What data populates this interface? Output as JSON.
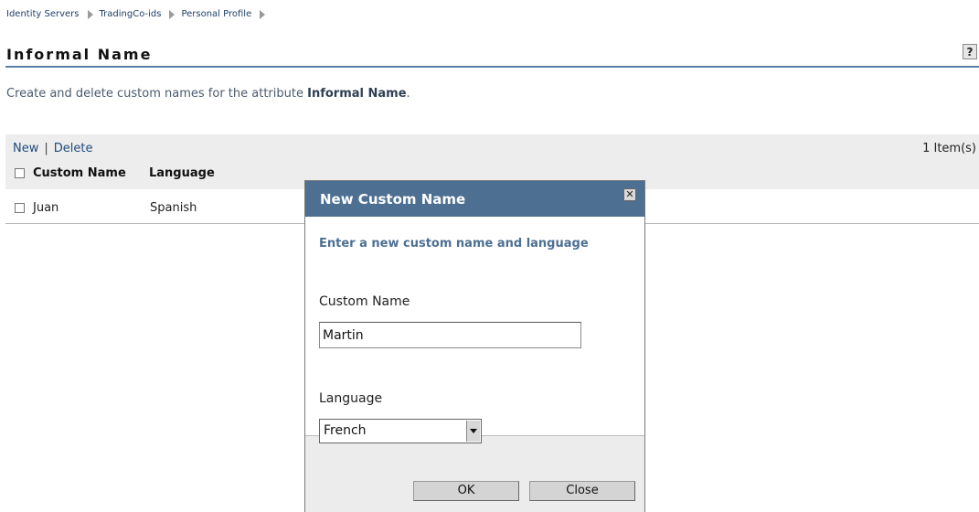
{
  "breadcrumb": [
    "Identity Servers",
    "TradingCo-ids",
    "Personal Profile"
  ],
  "page": {
    "title": "Informal Name",
    "help_label": "?",
    "description_prefix": "Create and delete custom names for the attribute ",
    "description_attribute": "Informal Name",
    "description_suffix": "."
  },
  "toolbar": {
    "new_label": "New",
    "separator": "|",
    "delete_label": "Delete",
    "item_count": "1 Item(s)"
  },
  "table": {
    "columns": [
      "Custom Name",
      "Language"
    ],
    "rows": [
      {
        "custom_name": "Juan",
        "language": "Spanish"
      }
    ]
  },
  "dialog": {
    "title": "New Custom Name",
    "close_glyph": "✕",
    "subtitle": "Enter a new custom name and language",
    "custom_name_label": "Custom Name",
    "custom_name_value": "Martin",
    "language_label": "Language",
    "language_value": "French",
    "ok_label": "OK",
    "close_label": "Close"
  }
}
